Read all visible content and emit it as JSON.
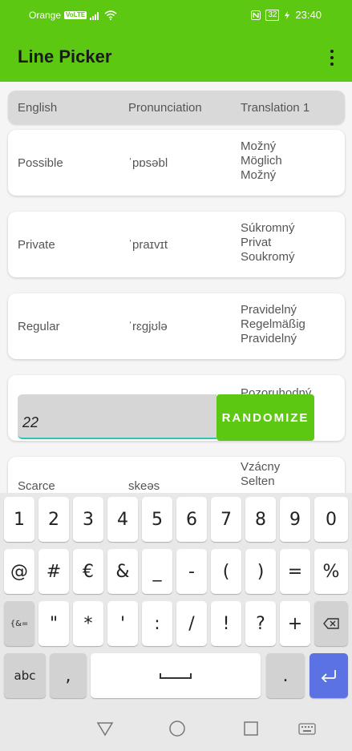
{
  "status_bar": {
    "carrier": "Orange",
    "volte": "VoLTE",
    "battery": "32",
    "time": "23:40"
  },
  "app_bar": {
    "title": "Line Picker",
    "menu_icon": "more-vert-icon"
  },
  "table": {
    "headers": [
      "English",
      "Pronunciation",
      "Translation 1"
    ],
    "rows": [
      {
        "english": "Possible",
        "pronunciation": "ˈpɒsəbl",
        "translations": [
          "Možný",
          "Möglich",
          "Možný"
        ]
      },
      {
        "english": "Private",
        "pronunciation": "ˈpraɪvɪt",
        "translations": [
          "Súkromný",
          "Privat",
          "Soukromý"
        ]
      },
      {
        "english": "Regular",
        "pronunciation": "ˈrɛgjʊlə",
        "translations": [
          "Pravidelný",
          "Regelmäßig",
          "Pravidelný"
        ]
      },
      {
        "english": "",
        "pronunciation": "",
        "translations": [
          "Pozoruhodný"
        ]
      },
      {
        "english": "Scarce",
        "pronunciation": "skeəs",
        "translations": [
          "Vzácny",
          "Selten"
        ]
      }
    ]
  },
  "randomizer": {
    "input_value": "22",
    "button_label": "RANDOMIZE"
  },
  "keyboard": {
    "row1": [
      "1",
      "2",
      "3",
      "4",
      "5",
      "6",
      "7",
      "8",
      "9",
      "0"
    ],
    "row2": [
      "@",
      "#",
      "€",
      "&",
      "_",
      "-",
      "(",
      ")",
      "=",
      "%"
    ],
    "row3": [
      "{&=",
      "\"",
      "*",
      "'",
      ":",
      "/",
      "!",
      "?",
      "+"
    ],
    "row4": {
      "abc": "abc",
      "comma": ",",
      "period": "."
    },
    "icons": {
      "backspace": "backspace-icon",
      "space": "space-bar-icon",
      "enter": "enter-icon"
    }
  },
  "nav_bar": {
    "icons": [
      "back-icon",
      "home-icon",
      "recents-icon",
      "keyboard-switch-icon"
    ]
  },
  "colors": {
    "primary": "#5cc811",
    "accent_underline": "#2ec4b6",
    "enter_key": "#5b72e4"
  }
}
